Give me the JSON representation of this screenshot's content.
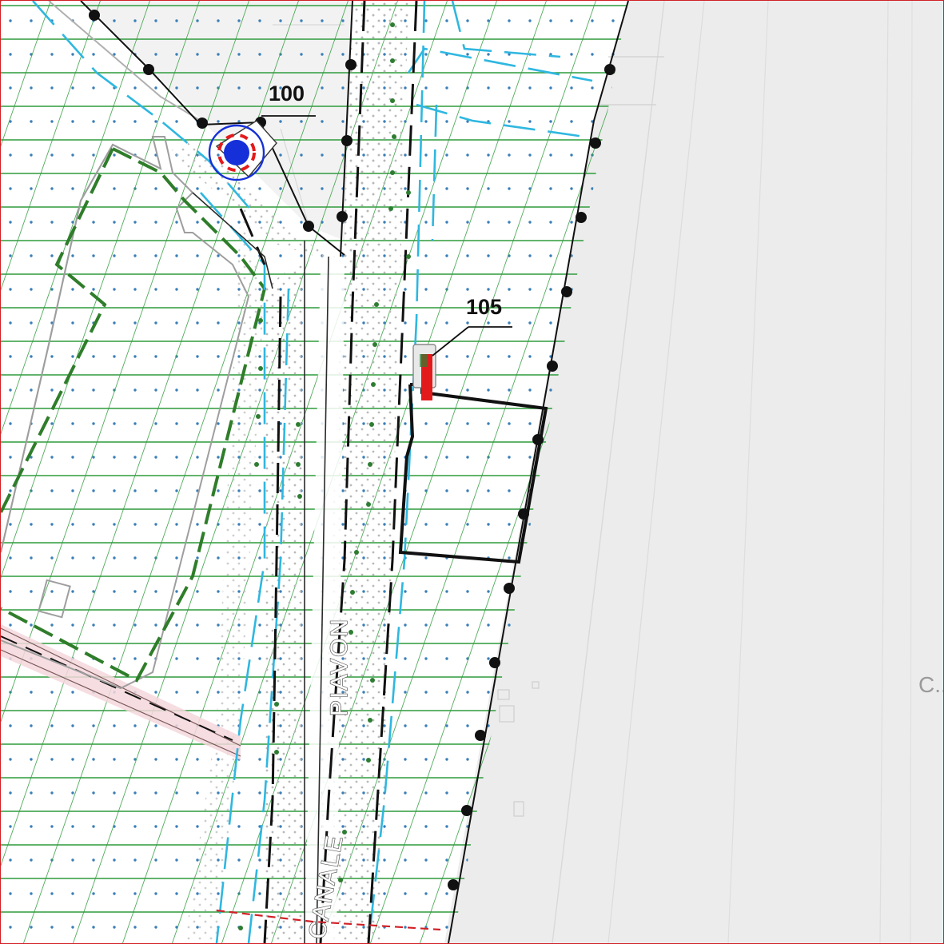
{
  "map": {
    "labels": {
      "point_100": "100",
      "point_105": "105",
      "street_canale": "CANALE",
      "street_piavon": "PIAVON",
      "place_fragment": "C..."
    },
    "colors": {
      "hatch_green": "#2e9b3c",
      "boundary_green_dashed": "#2f7d2a",
      "water_cyan": "#2fb7e0",
      "plot_outline_black": "#111111",
      "marker_blue": "#1530d8",
      "marker_red": "#e31a1c",
      "hydrant_red": "#e31a1c",
      "background_gray": "#ececec",
      "road_white": "#ffffff",
      "frame_red": "#d21f26"
    },
    "icons": {
      "point_100": "blue-circle-target-icon",
      "point_105": "red-hydrant-icon"
    }
  }
}
